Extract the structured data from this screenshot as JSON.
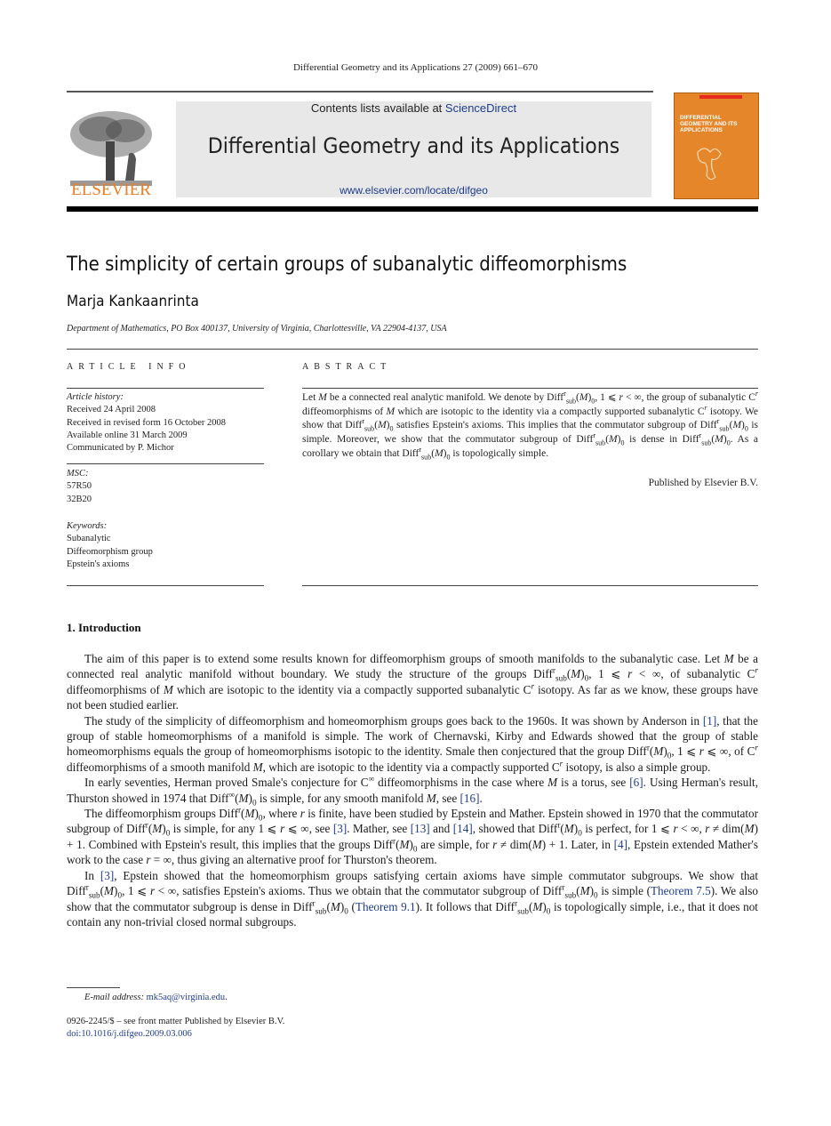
{
  "running_head": "Differential Geometry and its Applications 27 (2009) 661–670",
  "header": {
    "publisher_logo_text": "ELSEVIER",
    "contents_prefix": "Contents lists available at ",
    "contents_link": "ScienceDirect",
    "journal_title": "Differential Geometry and its Applications",
    "journal_url": "www.elsevier.com/locate/difgeo",
    "cover_title_lines": [
      "DIFFERENTIAL",
      "GEOMETRY AND ITS",
      "APPLICATIONS"
    ]
  },
  "colors": {
    "link": "#1f3b8f",
    "elsevier_orange": "#ef7d22",
    "cover_orange": "#e6862a",
    "banner_gray": "#e8e8e8"
  },
  "article": {
    "title": "The simplicity of certain groups of subanalytic diffeomorphisms",
    "author": "Marja Kankaanrinta",
    "affiliation": "Department of Mathematics, PO Box 400137, University of Virginia, Charlottesville, VA 22904-4137, USA"
  },
  "article_info": {
    "label": "ARTICLE INFO",
    "history_heading": "Article history:",
    "history": [
      "Received 24 April 2008",
      "Received in revised form 16 October 2008",
      "Available online 31 March 2009",
      "Communicated by P. Michor"
    ],
    "msc_heading": "MSC:",
    "msc": [
      "57R50",
      "32B20"
    ],
    "keywords_heading": "Keywords:",
    "keywords": [
      "Subanalytic",
      "Diffeomorphism group",
      "Epstein's axioms"
    ]
  },
  "abstract": {
    "label": "ABSTRACT",
    "publisher_line": "Published by Elsevier B.V."
  },
  "section": {
    "title": "1. Introduction",
    "citations": [
      "[1]",
      "[6]",
      "[16]",
      "[3]",
      "[13]",
      "[14]",
      "[4]",
      "[3]"
    ],
    "theorem_refs": [
      "Theorem 7.5",
      "Theorem 9.1"
    ]
  },
  "footnote": {
    "email_label": "E-mail address:",
    "email": "mk5aq@virginia.edu",
    "issn_line": "0926-2245/$ – see front matter  Published by Elsevier B.V.",
    "doi": "doi:10.1016/j.difgeo.2009.03.006"
  }
}
